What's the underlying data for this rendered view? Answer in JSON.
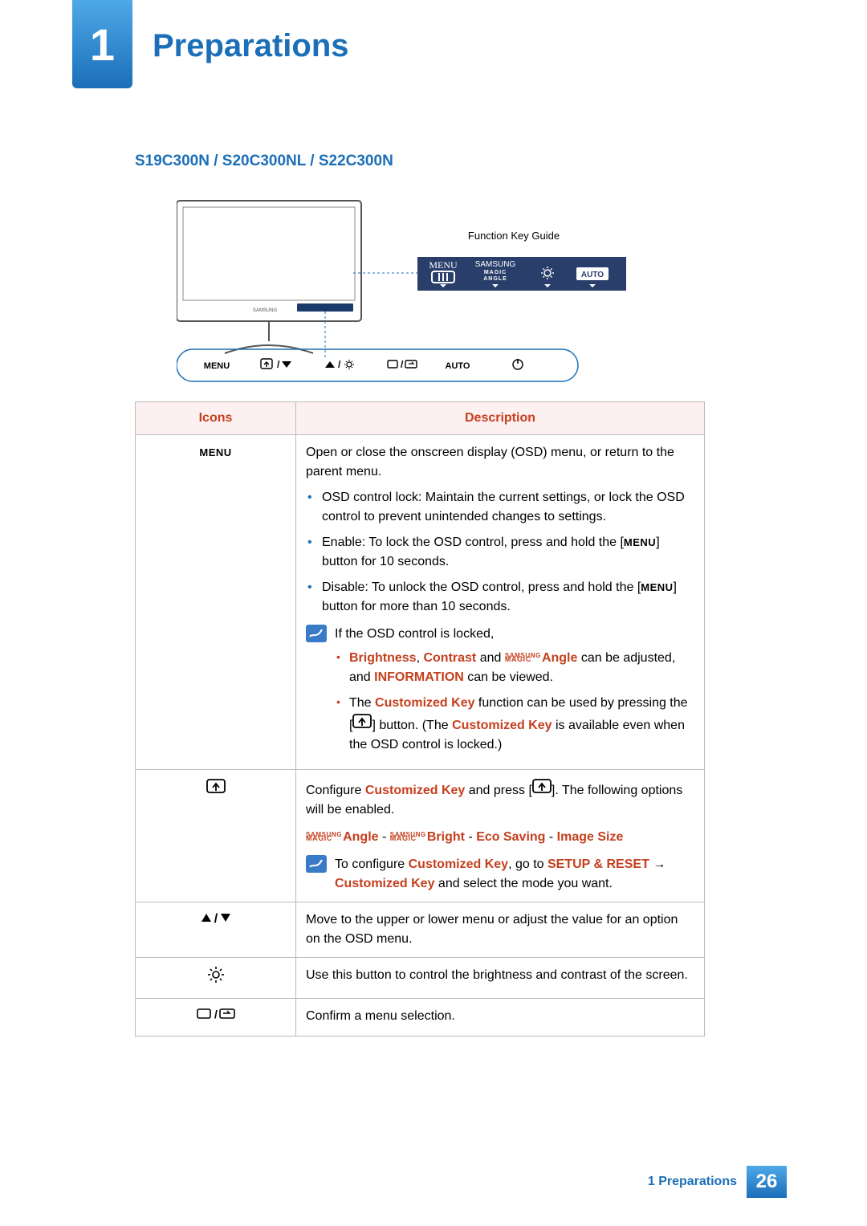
{
  "chapter": {
    "number": "1",
    "title": "Preparations"
  },
  "model_heading": "S19C300N / S20C300NL / S22C300N",
  "figure": {
    "guide_label": "Function Key Guide",
    "osd_buttons": {
      "menu": "MENU",
      "magic_top": "SAMSUNG",
      "magic_mid": "MAGIC",
      "magic_bot": "ANGLE",
      "auto": "AUTO"
    },
    "bottom_labels": {
      "menu": "MENU",
      "auto": "AUTO"
    }
  },
  "table": {
    "headers": {
      "icons": "Icons",
      "description": "Description"
    },
    "rows": {
      "menu": {
        "icon_label": "MENU",
        "intro": "Open or close the onscreen display (OSD) menu, or return to the parent menu.",
        "b1a": "OSD control lock: Maintain the current settings, or lock the OSD control to prevent unintended changes to settings.",
        "b2_pre": "Enable: To lock the OSD control, press and hold the [",
        "b2_menu": "MENU",
        "b2_post": "] button for 10 seconds.",
        "b3_pre": "Disable: To unlock the OSD control, press and hold the [",
        "b3_menu": "MENU",
        "b3_post": "] button for more than 10 seconds.",
        "note_lead": "If the OSD control is locked,",
        "n1_brightness": "Brightness",
        "n1_contrast": "Contrast",
        "n1_and": " and ",
        "n1_angle": "Angle",
        "n1_tail": " can be adjusted, and ",
        "n1_info": "INFORMATION",
        "n1_end": " can be viewed.",
        "n2_pre": "The ",
        "n2_ck1": "Customized Key",
        "n2_mid1": " function can be used by pressing the [",
        "n2_mid2": "] button. (The ",
        "n2_ck2": "Customized Key",
        "n2_end": " is available even when the OSD control is locked.)"
      },
      "customkey": {
        "p1_pre": "Configure ",
        "p1_ck": "Customized Key",
        "p1_mid": " and press [",
        "p1_post": "]. The following options will be enabled.",
        "opt_angle": "Angle",
        "sep1": " - ",
        "opt_bright": "Bright",
        "sep2": " - ",
        "opt_eco": "Eco Saving",
        "sep3": " - ",
        "opt_size": "Image Size",
        "note_pre": "To configure ",
        "note_ck": "Customized Key",
        "note_mid": ", go to ",
        "note_setup": "SETUP & RESET",
        "note_arrow": "  →  ",
        "note_ck2": "Customized Key",
        "note_end": " and select the mode you want."
      },
      "updown": {
        "text": "Move to the upper or lower menu or adjust the value for an option on the OSD menu."
      },
      "brightness": {
        "text": "Use this button to control the brightness and contrast of the screen."
      },
      "enter": {
        "text": "Confirm a menu selection."
      }
    }
  },
  "footer": {
    "chapter_ref": "1 Preparations",
    "page": "26"
  }
}
